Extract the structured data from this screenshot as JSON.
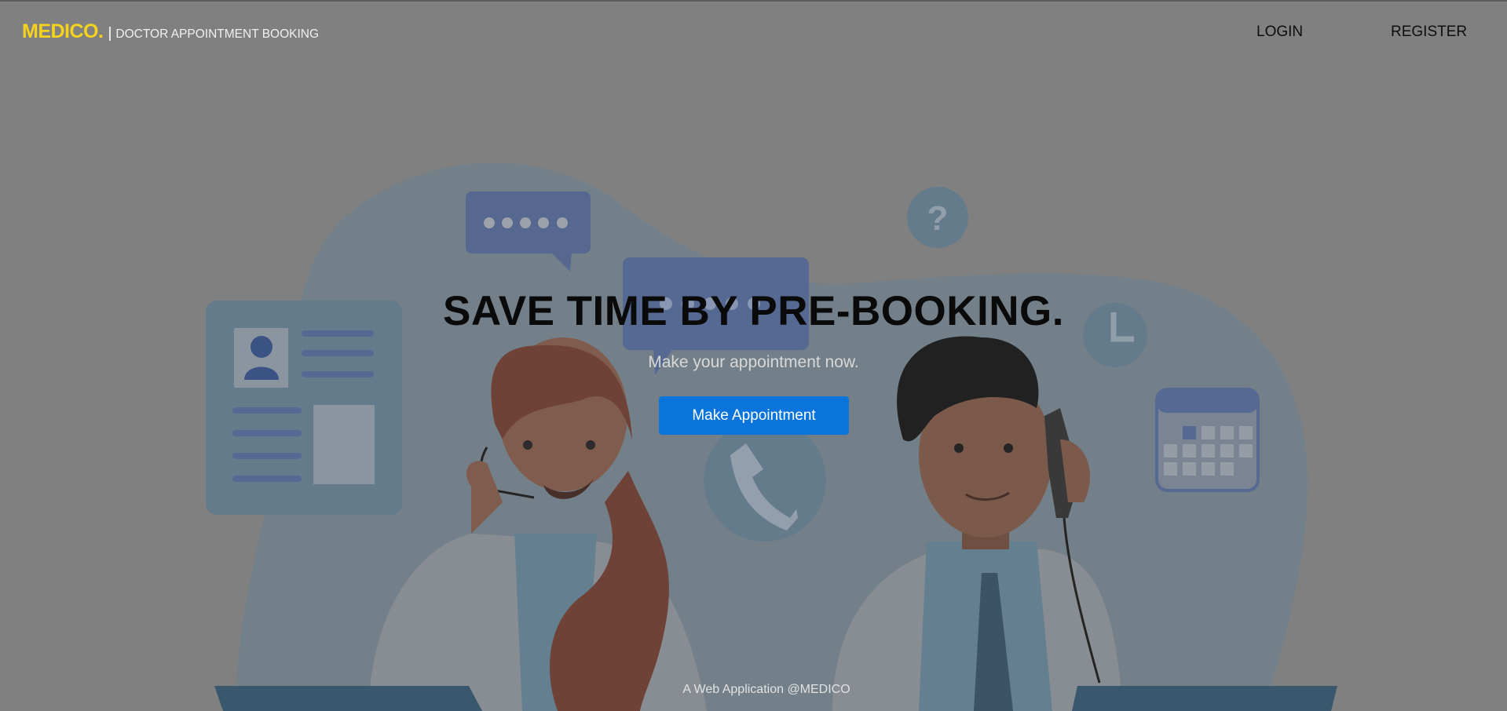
{
  "nav": {
    "brand": "MEDICO.",
    "separator": "|",
    "tagline": "DOCTOR APPOINTMENT BOOKING",
    "login": "LOGIN",
    "register": "REGISTER"
  },
  "hero": {
    "title": "SAVE TIME BY PRE-BOOKING.",
    "subtitle": "Make your appointment now.",
    "cta": "Make Appointment"
  },
  "footer": {
    "text": "A Web Application @MEDICO"
  },
  "illustration": {
    "description_icons": [
      "chat-bubble-icon",
      "question-icon",
      "clock-icon",
      "calendar-icon",
      "phone-icon",
      "id-card-icon"
    ],
    "question_mark": "?"
  },
  "colors": {
    "overlay": "#808080",
    "brand": "#f5d21c",
    "cta": "#0a74dd",
    "blob": "#6f7f8a",
    "icon_blue": "#4d6497"
  }
}
